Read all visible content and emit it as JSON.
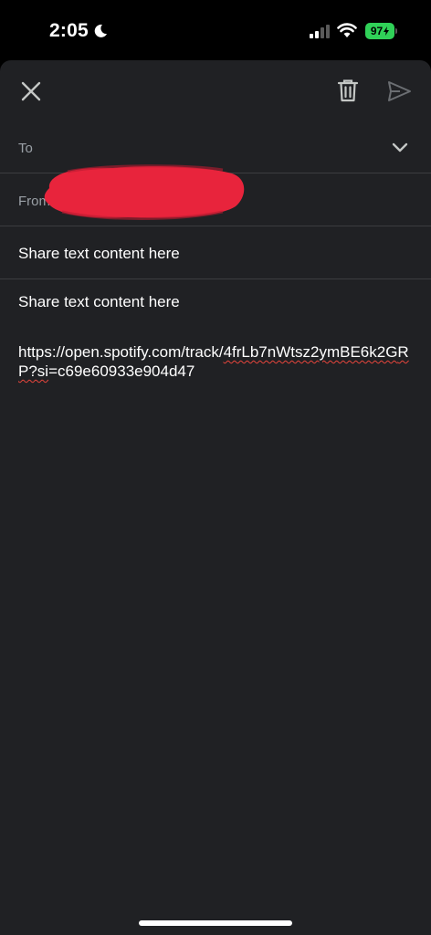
{
  "status_bar": {
    "time": "2:05",
    "battery": "97"
  },
  "compose": {
    "to_label": "To",
    "from_label": "From",
    "subject": "Share text content here",
    "body_text": "Share text content here",
    "body_url_plain": "https://open.spotify.com/track/",
    "body_url_marked_1": "4frLb7nWtsz2ymBE6k2G",
    "body_url_marked_2": "RP?si",
    "body_url_tail": "=c69e60933e904d47"
  },
  "colors": {
    "background": "#202124",
    "label": "#9aa0a6",
    "divider": "#3c3d40",
    "battery": "#30d158",
    "redaction": "#e8243c"
  },
  "icons": [
    "close-icon",
    "trash-icon",
    "send-icon",
    "chevron-down-icon",
    "moon-icon",
    "signal-icon",
    "wifi-icon",
    "battery-icon"
  ]
}
